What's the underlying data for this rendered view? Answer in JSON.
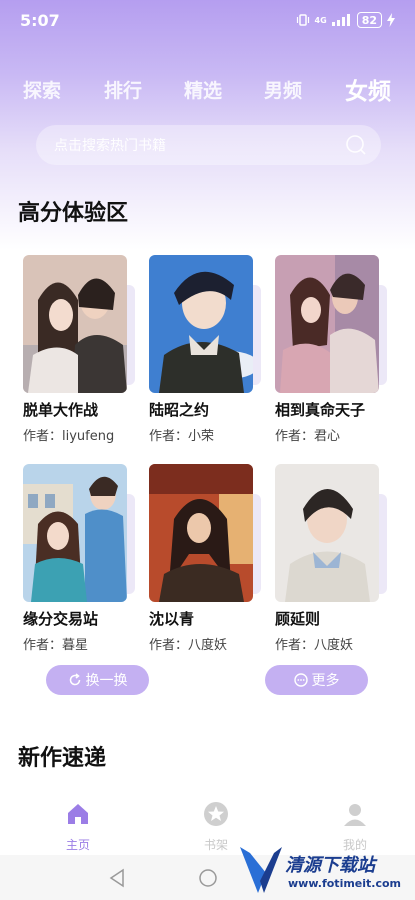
{
  "status": {
    "time": "5:07",
    "network": "4G",
    "battery": "82"
  },
  "tabs": [
    {
      "label": "探索"
    },
    {
      "label": "排行"
    },
    {
      "label": "精选"
    },
    {
      "label": "男频"
    },
    {
      "label": "女频"
    }
  ],
  "search": {
    "placeholder": "点击搜索热门书籍"
  },
  "section1": {
    "title": "高分体验区"
  },
  "books": [
    {
      "title": "脱单大作战",
      "author": "作者：liyufeng"
    },
    {
      "title": "陆昭之约",
      "author": "作者：小荣"
    },
    {
      "title": "相到真命天子",
      "author": "作者：君心"
    },
    {
      "title": "缘分交易站",
      "author": "作者：暮星"
    },
    {
      "title": "沈以青",
      "author": "作者：八度妖"
    },
    {
      "title": "顾延则",
      "author": "作者：八度妖"
    }
  ],
  "buttons": {
    "refresh": "换一换",
    "more": "更多"
  },
  "section2": {
    "title": "新作速递"
  },
  "nav": [
    {
      "label": "主页"
    },
    {
      "label": "书架"
    },
    {
      "label": "我的"
    }
  ],
  "watermark": {
    "name": "清源下载站",
    "url": "www.fotimeit.com"
  }
}
